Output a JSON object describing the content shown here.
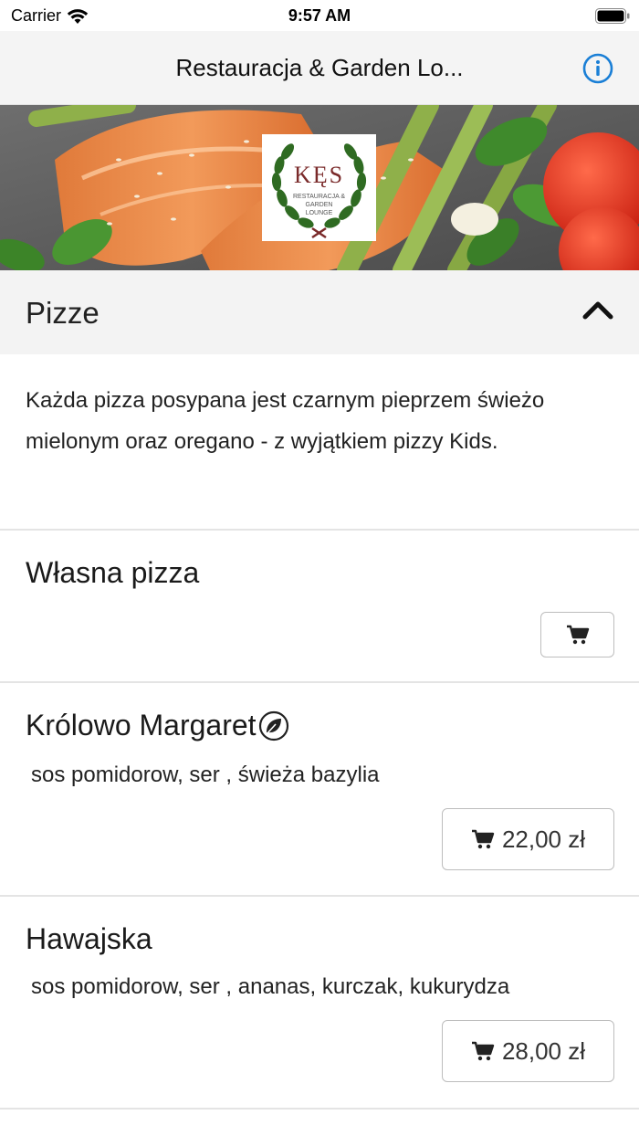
{
  "status_bar": {
    "carrier": "Carrier",
    "time": "9:57 AM"
  },
  "nav": {
    "title": "Restauracja & Garden Lo..."
  },
  "logo": {
    "text": "KĘS",
    "subtitle": "RESTAURACJA & GARDEN LOUNGE"
  },
  "category": {
    "title": "Pizze",
    "description": "Każda pizza posypana jest czarnym pieprzem świeżo mielonym oraz oregano - z wyjątkiem pizzy Kids."
  },
  "items": [
    {
      "name": "Własna pizza",
      "description": "",
      "price": ""
    },
    {
      "name": "Królowo Margaret",
      "description": "sos pomidorow, ser , świeża bazylia",
      "price": "22,00 zł",
      "vegetarian": true
    },
    {
      "name": "Hawajska",
      "description": "sos pomidorow, ser , ananas, kurczak, kukurydza",
      "price": "28,00 zł"
    }
  ],
  "icons": {
    "wifi": "wifi-icon",
    "battery": "battery-icon",
    "info": "info-icon",
    "chevron": "chevron-up-icon",
    "cart": "cart-icon",
    "leaf": "leaf-icon"
  },
  "colors": {
    "accent": "#1a7fd6",
    "header_bg": "#f4f4f4",
    "logo_red": "#7a2a2a",
    "laurel_green": "#2f6b22"
  }
}
